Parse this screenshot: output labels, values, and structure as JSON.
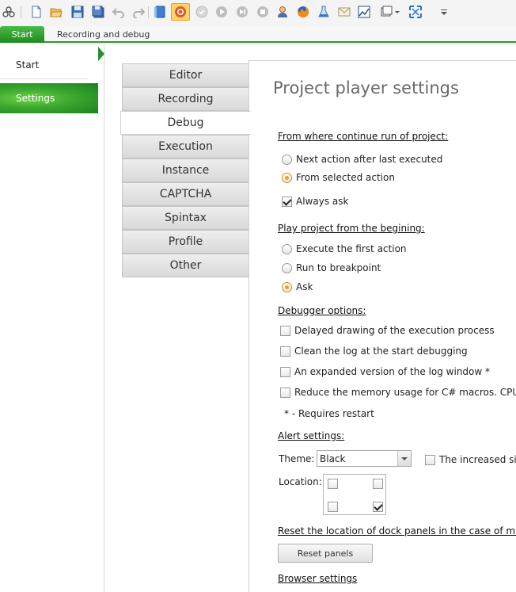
{
  "toolbar": {
    "icons": [
      "settings-cluster-icon",
      "new-file-icon",
      "open-folder-icon",
      "save-icon",
      "save-all-icon",
      "undo-icon",
      "redo-icon",
      "book-icon",
      "record-icon",
      "checkmark-circle-icon",
      "play-icon",
      "step-icon",
      "stop-icon",
      "user-icon",
      "firefox-icon",
      "flask-icon",
      "envelope-icon",
      "chart-icon",
      "window-layout-icon",
      "fullscreen-icon",
      "more-icon"
    ]
  },
  "tabs": {
    "start": "Start",
    "recording": "Recording and debug"
  },
  "nav": {
    "start": "Start",
    "settings": "Settings"
  },
  "categories": [
    "Editor",
    "Recording",
    "Debug",
    "Execution",
    "Instance",
    "CAPTCHA",
    "Spintax",
    "Profile",
    "Other"
  ],
  "active_category": "Debug",
  "main": {
    "title": "Project player settings",
    "continue": {
      "heading": "From where continue run of project:",
      "options": [
        "Next action after last executed",
        "From selected action"
      ],
      "selected": "From selected action",
      "always_ask": "Always ask",
      "always_ask_checked": true
    },
    "play": {
      "heading": "Play project from the begining:",
      "options": [
        "Execute the first action",
        "Run to breakpoint",
        "Ask"
      ],
      "selected": "Ask"
    },
    "debugger": {
      "heading": "Debugger options:",
      "options": [
        "Delayed drawing of the execution process",
        "Clean the log at the start debugging",
        "An expanded version of the log window *",
        "Reduce the memory usage for C# macros. CPU con"
      ],
      "note": "* - Requires restart"
    },
    "alert": {
      "heading": "Alert settings:",
      "theme_label": "Theme:",
      "theme_value": "Black",
      "increased_size_label": "The increased size",
      "location_label": "Location:",
      "location_checked": "bottom-right"
    },
    "reset": {
      "heading": "Reset the location of dock panels in the case of malfu",
      "button": "Reset panels"
    },
    "browser": {
      "heading": "Browser settings"
    }
  },
  "colors": {
    "accent_green": "#2a9a2a",
    "radio_selected": "#f0a020",
    "toolbar_active": "#ffd36b"
  }
}
